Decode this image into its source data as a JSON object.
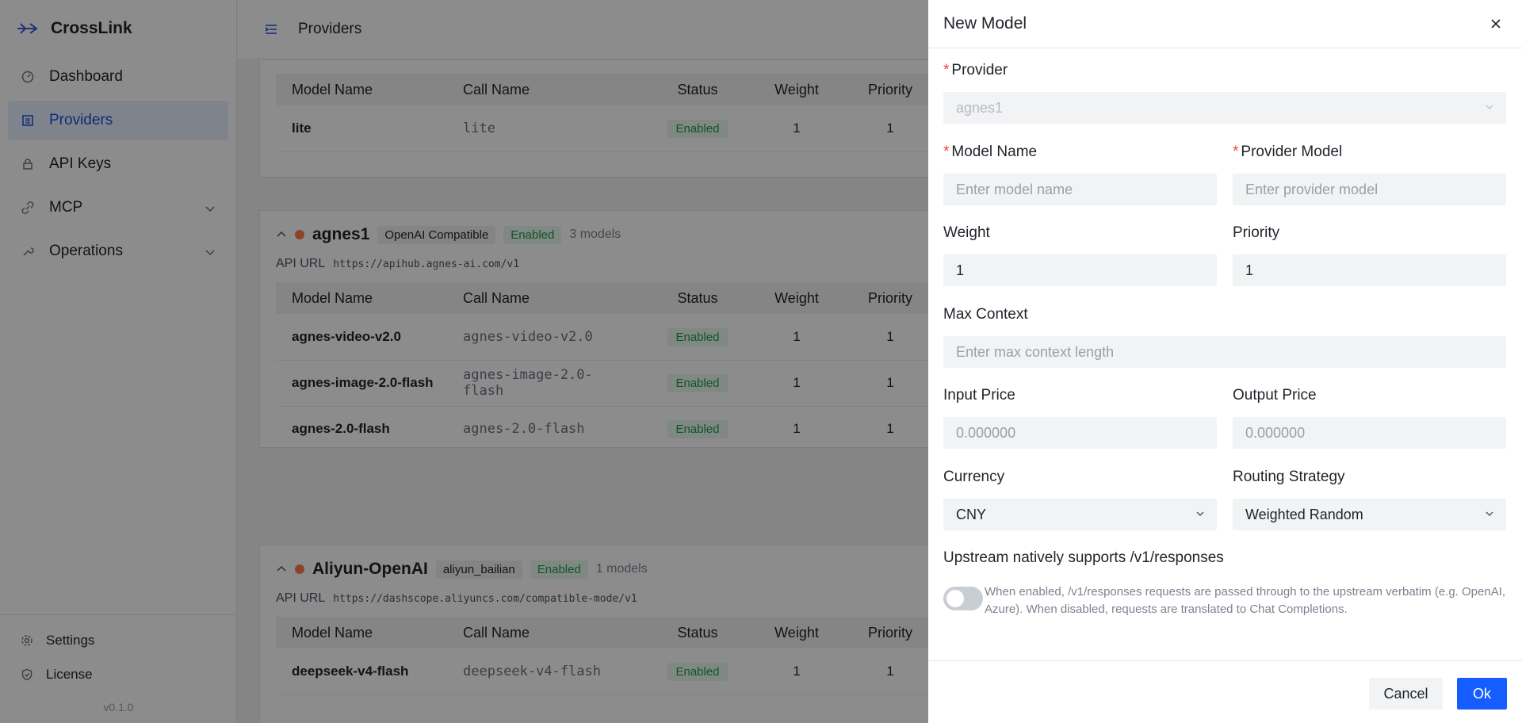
{
  "app": {
    "name": "CrossLink",
    "version": "v0.1.0"
  },
  "sidebar": {
    "items": [
      {
        "label": "Dashboard",
        "icon": "dashboard-icon"
      },
      {
        "label": "Providers",
        "icon": "list-icon",
        "active": true
      },
      {
        "label": "API Keys",
        "icon": "lock-icon"
      },
      {
        "label": "MCP",
        "icon": "link-icon",
        "expandable": true
      },
      {
        "label": "Operations",
        "icon": "wrench-icon",
        "expandable": true
      }
    ],
    "bottom": [
      {
        "label": "Settings",
        "icon": "gear-icon"
      },
      {
        "label": "License",
        "icon": "shield-check-icon"
      }
    ]
  },
  "header": {
    "title": "Providers"
  },
  "table_columns": {
    "model_name": "Model Name",
    "call_name": "Call Name",
    "status": "Status",
    "weight": "Weight",
    "priority": "Priority"
  },
  "api_url_label": "API URL",
  "providers": [
    {
      "rows": [
        {
          "name": "lite",
          "call": "lite",
          "status": "Enabled",
          "weight": "1",
          "priority": "1"
        }
      ]
    },
    {
      "name": "agnes1",
      "type": "OpenAI Compatible",
      "status": "Enabled",
      "count": "3 models",
      "api_url": "https://apihub.agnes-ai.com/v1",
      "rows": [
        {
          "name": "agnes-video-v2.0",
          "call": "agnes-video-v2.0",
          "status": "Enabled",
          "weight": "1",
          "priority": "1"
        },
        {
          "name": "agnes-image-2.0-flash",
          "call": "agnes-image-2.0-flash",
          "status": "Enabled",
          "weight": "1",
          "priority": "1"
        },
        {
          "name": "agnes-2.0-flash",
          "call": "agnes-2.0-flash",
          "status": "Enabled",
          "weight": "1",
          "priority": "1"
        }
      ]
    },
    {
      "name": "Aliyun-OpenAI",
      "type": "aliyun_bailian",
      "status": "Enabled",
      "count": "1 models",
      "api_url": "https://dashscope.aliyuncs.com/compatible-mode/v1",
      "rows": [
        {
          "name": "deepseek-v4-flash",
          "call": "deepseek-v4-flash",
          "status": "Enabled",
          "weight": "1",
          "priority": "1"
        }
      ]
    }
  ],
  "drawer": {
    "title": "New Model",
    "provider": {
      "label": "Provider",
      "value": "agnes1"
    },
    "model_name": {
      "label": "Model Name",
      "placeholder": "Enter model name"
    },
    "provider_model": {
      "label": "Provider Model",
      "placeholder": "Enter provider model"
    },
    "weight": {
      "label": "Weight",
      "value": "1"
    },
    "priority": {
      "label": "Priority",
      "value": "1"
    },
    "max_context": {
      "label": "Max Context",
      "placeholder": "Enter max context length"
    },
    "input_price": {
      "label": "Input Price",
      "placeholder": "0.000000"
    },
    "output_price": {
      "label": "Output Price",
      "placeholder": "0.000000"
    },
    "currency": {
      "label": "Currency",
      "value": "CNY"
    },
    "routing": {
      "label": "Routing Strategy",
      "value": "Weighted Random"
    },
    "responses": {
      "label": "Upstream natively supports /v1/responses",
      "enabled": false,
      "description": "When enabled, /v1/responses requests are passed through to the upstream verbatim (e.g. OpenAI, Azure). When disabled, requests are translated to Chat Completions."
    },
    "cancel_label": "Cancel",
    "ok_label": "Ok"
  },
  "colors": {
    "accent": "#165dff",
    "enabled_green": "#1e9b4f",
    "required": "#f53f3f",
    "provider_dot": "#ff7a45"
  }
}
